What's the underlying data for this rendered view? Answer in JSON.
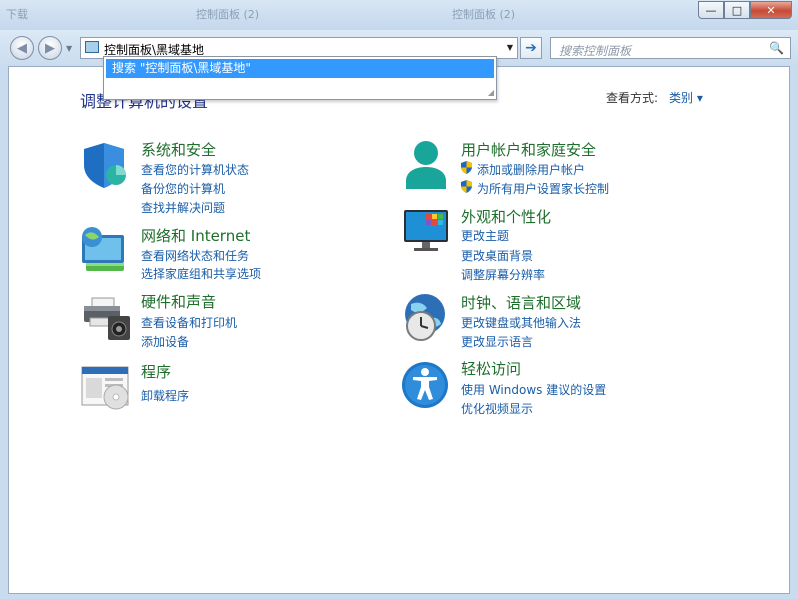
{
  "titlebar": {
    "ghost_tabs": [
      "下载",
      "控制面板 (2)",
      "控制面板 (2)"
    ],
    "buttons": {
      "minimize": "—",
      "maximize": "□",
      "close": "✕"
    }
  },
  "nav": {
    "back_icon": "back-arrow-icon",
    "forward_icon": "forward-arrow-icon",
    "address": "控制面板\\黑域基地",
    "go_icon": "go-arrow-icon",
    "search_placeholder": "搜索控制面板"
  },
  "autocomplete": {
    "item": "搜索 \"控制面板\\黑域基地\""
  },
  "page": {
    "heading": "调整计算机的设置",
    "view_by_label": "查看方式:",
    "view_by_value": "类别"
  },
  "categories": {
    "system": {
      "title": "系统和安全",
      "links": [
        "查看您的计算机状态",
        "备份您的计算机",
        "查找并解决问题"
      ]
    },
    "network": {
      "title": "网络和 Internet",
      "links": [
        "查看网络状态和任务",
        "选择家庭组和共享选项"
      ]
    },
    "hardware": {
      "title": "硬件和声音",
      "links": [
        "查看设备和打印机",
        "添加设备"
      ]
    },
    "programs": {
      "title": "程序",
      "links": [
        "卸载程序"
      ]
    },
    "users": {
      "title": "用户帐户和家庭安全",
      "links": [
        "添加或删除用户帐户",
        "为所有用户设置家长控制"
      ]
    },
    "appearance": {
      "title": "外观和个性化",
      "links": [
        "更改主题",
        "更改桌面背景",
        "调整屏幕分辨率"
      ]
    },
    "clock": {
      "title": "时钟、语言和区域",
      "links": [
        "更改键盘或其他输入法",
        "更改显示语言"
      ]
    },
    "ease": {
      "title": "轻松访问",
      "links": [
        "使用 Windows 建议的设置",
        "优化视频显示"
      ]
    }
  },
  "colors": {
    "link": "#1a5ea8",
    "category_title": "#1e6e2c",
    "highlight": "#3399ff"
  }
}
